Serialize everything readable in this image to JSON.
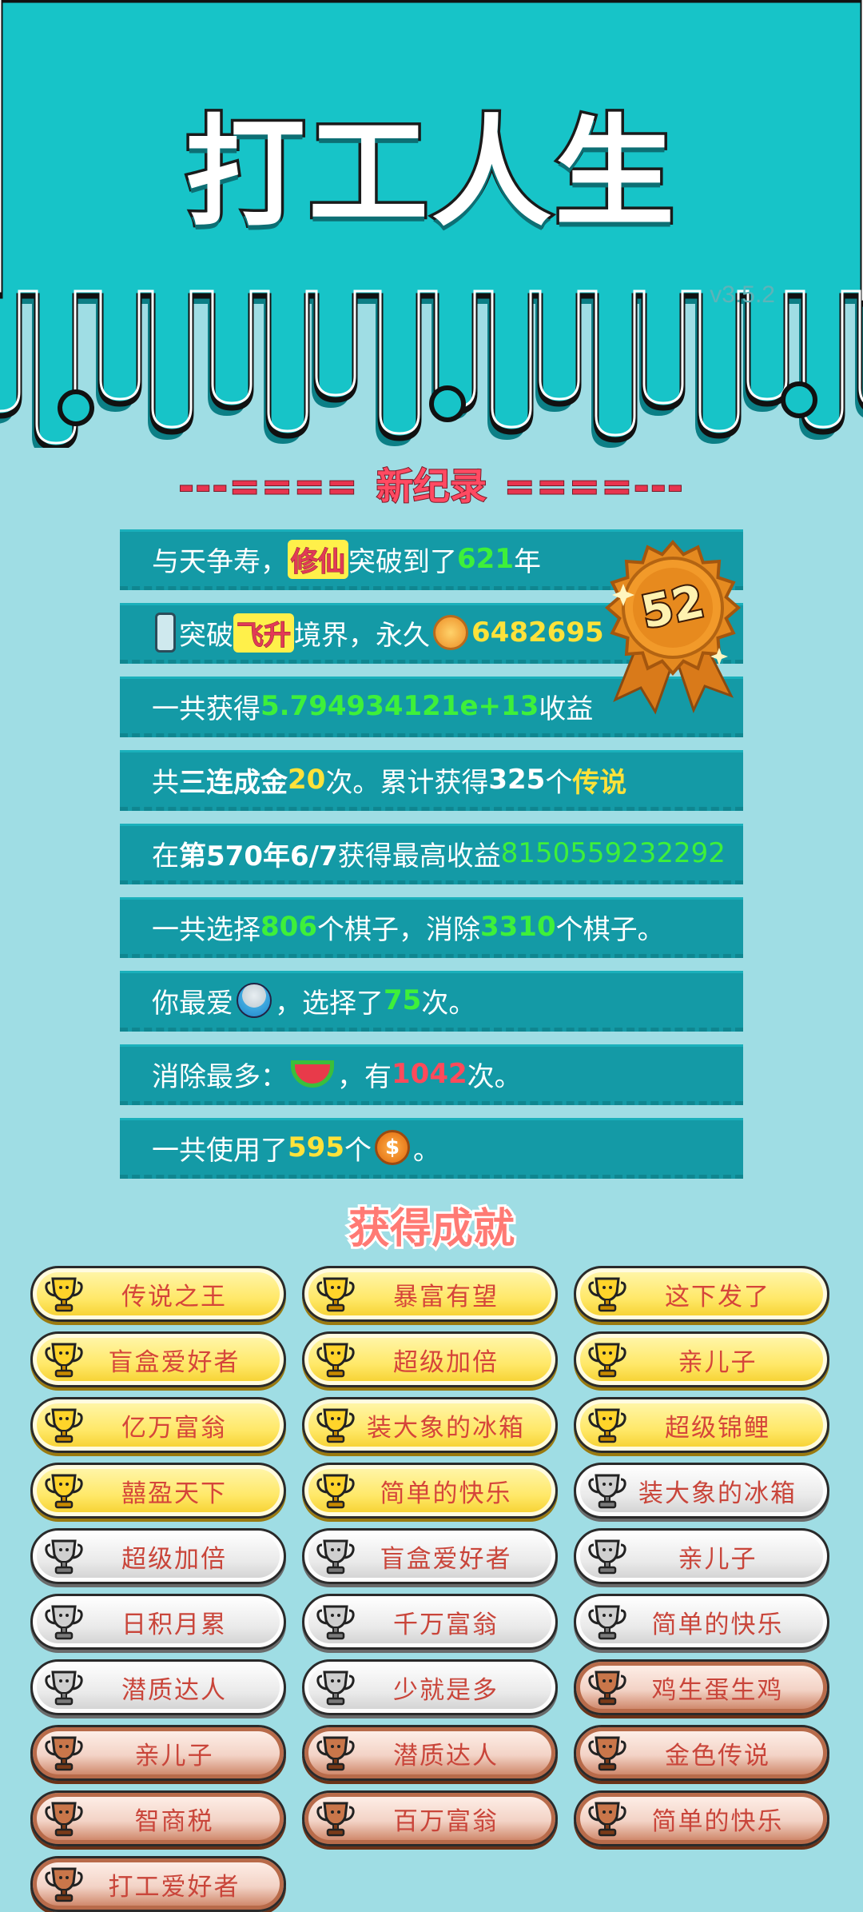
{
  "app": {
    "title": "打工人生",
    "version": "v3.5.2"
  },
  "record": {
    "heading": "新纪录",
    "dashes_left": "---====",
    "dashes_right": "====---",
    "medal_number": "52",
    "rows": [
      {
        "parts": [
          {
            "t": "与天争寿，",
            "c": "n"
          },
          {
            "t": "修仙",
            "c": "tag"
          },
          {
            "t": "突破到了",
            "c": "n"
          },
          {
            "t": "621",
            "c": "g"
          },
          {
            "t": "年",
            "c": "n"
          }
        ]
      },
      {
        "parts": [
          {
            "t": "fridge-icon",
            "c": "icon"
          },
          {
            "t": "突破",
            "c": "n"
          },
          {
            "t": "飞升",
            "c": "tag"
          },
          {
            "t": "境界，永久",
            "c": "n"
          },
          {
            "t": "heart-coin",
            "c": "icon"
          },
          {
            "t": "6482695",
            "c": "y"
          }
        ]
      },
      {
        "parts": [
          {
            "t": "一共获得",
            "c": "n"
          },
          {
            "t": "5.794934121e+13",
            "c": "g"
          },
          {
            "t": "收益",
            "c": "n"
          }
        ]
      },
      {
        "parts": [
          {
            "t": "共",
            "c": "n"
          },
          {
            "t": "三连成金",
            "c": "b"
          },
          {
            "t": "20",
            "c": "y"
          },
          {
            "t": "次。累计获得",
            "c": "n"
          },
          {
            "t": "325",
            "c": "b"
          },
          {
            "t": "个",
            "c": "n"
          },
          {
            "t": "传说",
            "c": "y"
          }
        ]
      },
      {
        "parts": [
          {
            "t": "在 ",
            "c": "n"
          },
          {
            "t": "第570年6/7",
            "c": "b"
          },
          {
            "t": " 获得最高收益",
            "c": "n"
          },
          {
            "t": "8150559232292",
            "c": "gthin"
          }
        ]
      },
      {
        "parts": [
          {
            "t": "一共选择",
            "c": "n"
          },
          {
            "t": "806",
            "c": "g"
          },
          {
            "t": "个棋子，消除",
            "c": "n"
          },
          {
            "t": "3310",
            "c": "g"
          },
          {
            "t": "个棋子。",
            "c": "n"
          }
        ]
      },
      {
        "parts": [
          {
            "t": "你最爱",
            "c": "n"
          },
          {
            "t": "rice-bowl-icon",
            "c": "icon"
          },
          {
            "t": "，选择了",
            "c": "n"
          },
          {
            "t": "75",
            "c": "g"
          },
          {
            "t": "次。",
            "c": "n"
          }
        ]
      },
      {
        "parts": [
          {
            "t": "消除最多：",
            "c": "n"
          },
          {
            "t": "watermelon-icon",
            "c": "icon"
          },
          {
            "t": "，有",
            "c": "n"
          },
          {
            "t": "1042",
            "c": "r"
          },
          {
            "t": "次。",
            "c": "n"
          }
        ]
      },
      {
        "parts": [
          {
            "t": "一共使用了",
            "c": "n"
          },
          {
            "t": "595",
            "c": "y"
          },
          {
            "t": "个",
            "c": "n"
          },
          {
            "t": "coin-icon",
            "c": "icon"
          },
          {
            "t": "。",
            "c": "n"
          }
        ]
      }
    ]
  },
  "achievements": {
    "heading": "获得成就",
    "items": [
      {
        "label": "传说之王",
        "tier": "gold"
      },
      {
        "label": "暴富有望",
        "tier": "gold"
      },
      {
        "label": "这下发了",
        "tier": "gold"
      },
      {
        "label": "盲盒爱好者",
        "tier": "gold"
      },
      {
        "label": "超级加倍",
        "tier": "gold"
      },
      {
        "label": "亲儿子",
        "tier": "gold"
      },
      {
        "label": "亿万富翁",
        "tier": "gold"
      },
      {
        "label": "装大象的冰箱",
        "tier": "gold"
      },
      {
        "label": "超级锦鲤",
        "tier": "gold"
      },
      {
        "label": "囍盈天下",
        "tier": "gold"
      },
      {
        "label": "简单的快乐",
        "tier": "gold"
      },
      {
        "label": "装大象的冰箱",
        "tier": "silver"
      },
      {
        "label": "超级加倍",
        "tier": "silver"
      },
      {
        "label": "盲盒爱好者",
        "tier": "silver"
      },
      {
        "label": "亲儿子",
        "tier": "silver"
      },
      {
        "label": "日积月累",
        "tier": "silver"
      },
      {
        "label": "千万富翁",
        "tier": "silver"
      },
      {
        "label": "简单的快乐",
        "tier": "silver"
      },
      {
        "label": "潜质达人",
        "tier": "silver"
      },
      {
        "label": "少就是多",
        "tier": "silver"
      },
      {
        "label": "鸡生蛋生鸡",
        "tier": "bronze"
      },
      {
        "label": "亲儿子",
        "tier": "bronze"
      },
      {
        "label": "潜质达人",
        "tier": "bronze"
      },
      {
        "label": "金色传说",
        "tier": "bronze"
      },
      {
        "label": "智商税",
        "tier": "bronze"
      },
      {
        "label": "百万富翁",
        "tier": "bronze"
      },
      {
        "label": "简单的快乐",
        "tier": "bronze"
      },
      {
        "label": "打工爱好者",
        "tier": "bronze"
      }
    ]
  },
  "colors": {
    "top_teal": "#17c4c8",
    "bg": "#9fdde4",
    "row_bg": "#149aa6",
    "green": "#3ef03a",
    "yellow": "#ffe23a",
    "red": "#ff4a5a",
    "gold_badge": "#ffe868",
    "silver_badge": "#eaeaea",
    "bronze_badge": "#f3d3c6"
  }
}
